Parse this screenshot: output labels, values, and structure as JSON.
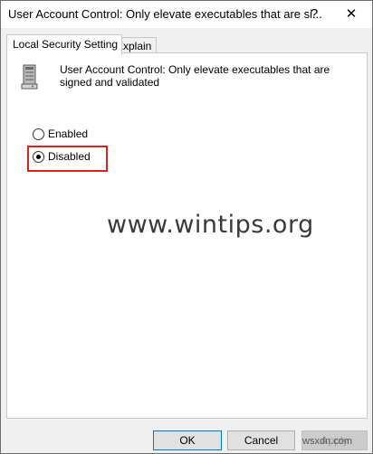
{
  "window": {
    "title": "User Account Control: Only elevate executables that are si...",
    "help_glyph": "?",
    "close_glyph": "✕"
  },
  "tabs": [
    {
      "label": "Local Security Setting",
      "active": true
    },
    {
      "label": "Explain",
      "active": false
    }
  ],
  "policy": {
    "icon": "server-policy-icon",
    "description": "User Account Control: Only elevate executables that are signed and validated"
  },
  "options": [
    {
      "label": "Enabled",
      "selected": false
    },
    {
      "label": "Disabled",
      "selected": true
    }
  ],
  "watermark": "www.wintips.org",
  "footer_watermark": "wsxdn.com",
  "buttons": {
    "ok": "OK",
    "cancel": "Cancel",
    "apply": "Apply"
  },
  "colors": {
    "highlight": "#e02020",
    "ok_border": "#0078d7"
  }
}
